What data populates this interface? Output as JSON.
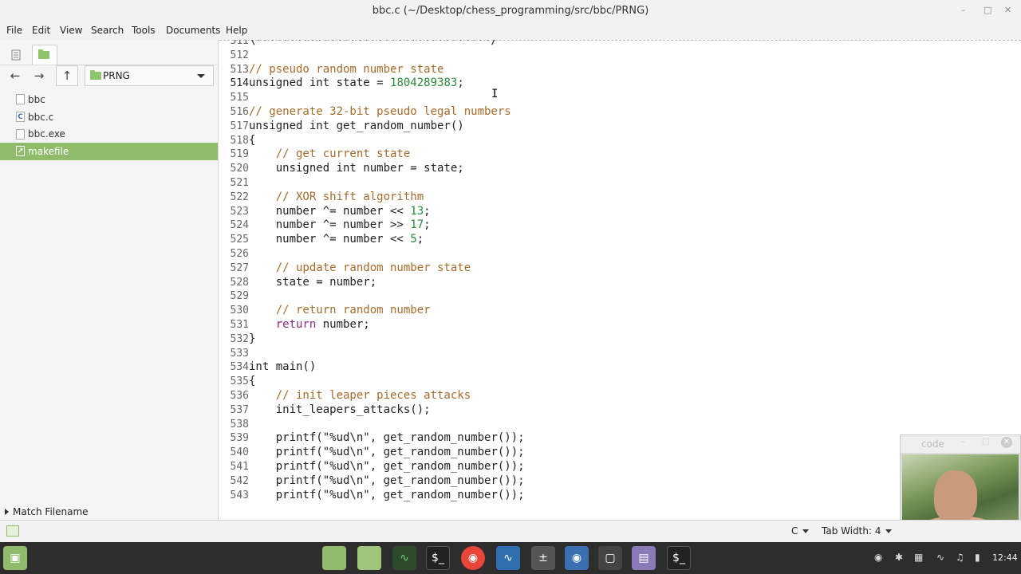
{
  "window": {
    "title": "bbc.c (~/Desktop/chess_programming/src/bbc/PRNG)"
  },
  "menu": [
    "File",
    "Edit",
    "View",
    "Search",
    "Tools",
    "Documents",
    "Help"
  ],
  "sidebar": {
    "folder": "PRNG",
    "files": [
      {
        "name": "bbc",
        "icon": "generic-file-icon"
      },
      {
        "name": "bbc.c",
        "icon": "c-source-icon"
      },
      {
        "name": "bbc.exe",
        "icon": "generic-file-icon"
      },
      {
        "name": "makefile",
        "icon": "makefile-icon",
        "selected": true
      }
    ],
    "match_filename": "Match Filename"
  },
  "editor": {
    "current_line": "514",
    "lines": [
      {
        "n": "511",
        "parts": [
          [
            "",
            "\\***********************************/"
          ]
        ]
      },
      {
        "n": "512",
        "parts": []
      },
      {
        "n": "513",
        "parts": [
          [
            "cm",
            "// pseudo random number state"
          ]
        ]
      },
      {
        "n": "514",
        "parts": [
          [
            "",
            "unsigned int state = "
          ],
          [
            "num",
            "1804289383"
          ],
          [
            "",
            ";"
          ]
        ]
      },
      {
        "n": "515",
        "parts": []
      },
      {
        "n": "516",
        "parts": [
          [
            "cm",
            "// generate 32-bit pseudo legal numbers"
          ]
        ]
      },
      {
        "n": "517",
        "parts": [
          [
            "",
            "unsigned int get_random_number()"
          ]
        ]
      },
      {
        "n": "518",
        "parts": [
          [
            "",
            "{"
          ]
        ]
      },
      {
        "n": "519",
        "parts": [
          [
            "",
            "    "
          ],
          [
            "cm",
            "// get current state"
          ]
        ]
      },
      {
        "n": "520",
        "parts": [
          [
            "",
            "    unsigned int number = state;"
          ]
        ]
      },
      {
        "n": "521",
        "parts": []
      },
      {
        "n": "522",
        "parts": [
          [
            "",
            "    "
          ],
          [
            "cm",
            "// XOR shift algorithm"
          ]
        ]
      },
      {
        "n": "523",
        "parts": [
          [
            "",
            "    number ^= number << "
          ],
          [
            "num",
            "13"
          ],
          [
            "",
            ";"
          ]
        ]
      },
      {
        "n": "524",
        "parts": [
          [
            "",
            "    number ^= number >> "
          ],
          [
            "num",
            "17"
          ],
          [
            "",
            ";"
          ]
        ]
      },
      {
        "n": "525",
        "parts": [
          [
            "",
            "    number ^= number << "
          ],
          [
            "num",
            "5"
          ],
          [
            "",
            ";"
          ]
        ]
      },
      {
        "n": "526",
        "parts": []
      },
      {
        "n": "527",
        "parts": [
          [
            "",
            "    "
          ],
          [
            "cm",
            "// update random number state"
          ]
        ]
      },
      {
        "n": "528",
        "parts": [
          [
            "",
            "    state = number;"
          ]
        ]
      },
      {
        "n": "529",
        "parts": []
      },
      {
        "n": "530",
        "parts": [
          [
            "",
            "    "
          ],
          [
            "cm",
            "// return random number"
          ]
        ]
      },
      {
        "n": "531",
        "parts": [
          [
            "",
            "    "
          ],
          [
            "kw",
            "return"
          ],
          [
            "",
            " number;"
          ]
        ]
      },
      {
        "n": "532",
        "parts": [
          [
            "",
            "}"
          ]
        ]
      },
      {
        "n": "533",
        "parts": []
      },
      {
        "n": "534",
        "parts": [
          [
            "",
            "int main()"
          ]
        ]
      },
      {
        "n": "535",
        "parts": [
          [
            "",
            "{"
          ]
        ]
      },
      {
        "n": "536",
        "parts": [
          [
            "",
            "    "
          ],
          [
            "cm",
            "// init leaper pieces attacks"
          ]
        ]
      },
      {
        "n": "537",
        "parts": [
          [
            "",
            "    init_leapers_attacks();"
          ]
        ]
      },
      {
        "n": "538",
        "parts": []
      },
      {
        "n": "539",
        "parts": [
          [
            "",
            "    printf("
          ],
          [
            "str",
            "\"%ud\\n\""
          ],
          [
            "",
            ", get_random_number());"
          ]
        ]
      },
      {
        "n": "540",
        "parts": [
          [
            "",
            "    printf("
          ],
          [
            "str",
            "\"%ud\\n\""
          ],
          [
            "",
            ", get_random_number());"
          ]
        ]
      },
      {
        "n": "541",
        "parts": [
          [
            "",
            "    printf("
          ],
          [
            "str",
            "\"%ud\\n\""
          ],
          [
            "",
            ", get_random_number());"
          ]
        ]
      },
      {
        "n": "542",
        "parts": [
          [
            "",
            "    printf("
          ],
          [
            "str",
            "\"%ud\\n\""
          ],
          [
            "",
            ", get_random_number());"
          ]
        ]
      },
      {
        "n": "543",
        "parts": [
          [
            "",
            "    printf("
          ],
          [
            "str",
            "\"%ud\\n\""
          ],
          [
            "",
            ", get_random_number());"
          ]
        ]
      }
    ]
  },
  "camera_window": {
    "title": "code"
  },
  "statusbar": {
    "language": "C",
    "tab_width": "Tab Width: 4"
  },
  "taskbar": {
    "clock": "12:44"
  },
  "colors": {
    "accent": "#8fbb6b",
    "comment": "#a66b2b",
    "number": "#2a8a3a",
    "keyword": "#8a2a8a"
  }
}
